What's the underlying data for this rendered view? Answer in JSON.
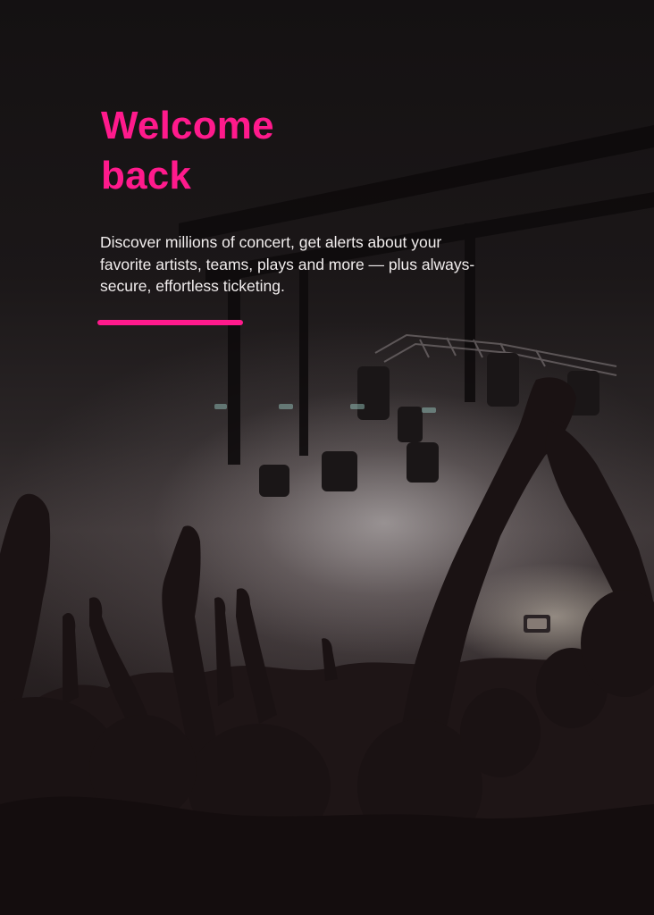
{
  "hero": {
    "headline_line1": "Welcome",
    "headline_line2": "back",
    "tagline": "Discover millions of concert, get alerts about your favorite artists, teams, plays and more — plus always-secure, effortless ticketing."
  },
  "theme": {
    "accent": "#ff1a8c",
    "background": "#120f10",
    "text": "#f2eeee"
  },
  "image": {
    "subject": "concert-crowd-photo"
  }
}
